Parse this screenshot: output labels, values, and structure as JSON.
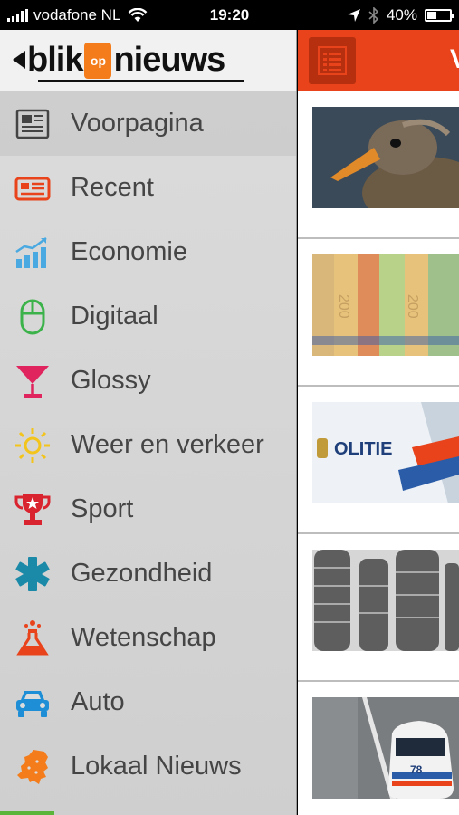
{
  "status_bar": {
    "carrier": "vodafone NL",
    "time": "19:20",
    "battery": "40%",
    "battery_level": 0.4
  },
  "sidebar": {
    "logo": {
      "left": "blik",
      "middle": "op",
      "right": "nieuws"
    },
    "items": [
      {
        "label": "Voorpagina",
        "icon": "newspaper-icon",
        "color": "#444444",
        "active": true
      },
      {
        "label": "Recent",
        "icon": "news-recent-icon",
        "color": "#e8431b"
      },
      {
        "label": "Economie",
        "icon": "chart-growth-icon",
        "color": "#4aa9e0"
      },
      {
        "label": "Digitaal",
        "icon": "mouse-icon",
        "color": "#3cb24a"
      },
      {
        "label": "Glossy",
        "icon": "cocktail-glass-icon",
        "color": "#e0245e"
      },
      {
        "label": "Weer en verkeer",
        "icon": "sun-icon",
        "color": "#f3c41b"
      },
      {
        "label": "Sport",
        "icon": "trophy-icon",
        "color": "#d9232e"
      },
      {
        "label": "Gezondheid",
        "icon": "medical-asterisk-icon",
        "color": "#1b8aa8"
      },
      {
        "label": "Wetenschap",
        "icon": "flask-icon",
        "color": "#e8431b"
      },
      {
        "label": "Auto",
        "icon": "car-icon",
        "color": "#1e8fd6"
      },
      {
        "label": "Lokaal Nieuws",
        "icon": "netherlands-map-icon",
        "color": "#f47c1a"
      }
    ]
  },
  "main": {
    "header_letter": "V",
    "articles": [
      {
        "thumb": "duck"
      },
      {
        "thumb": "euro-notes"
      },
      {
        "thumb": "police-car-door"
      },
      {
        "thumb": "coin-stacks"
      },
      {
        "thumb": "police-car-road"
      }
    ]
  },
  "colors": {
    "accent": "#e8431b",
    "logo_orange": "#f47c1a"
  }
}
